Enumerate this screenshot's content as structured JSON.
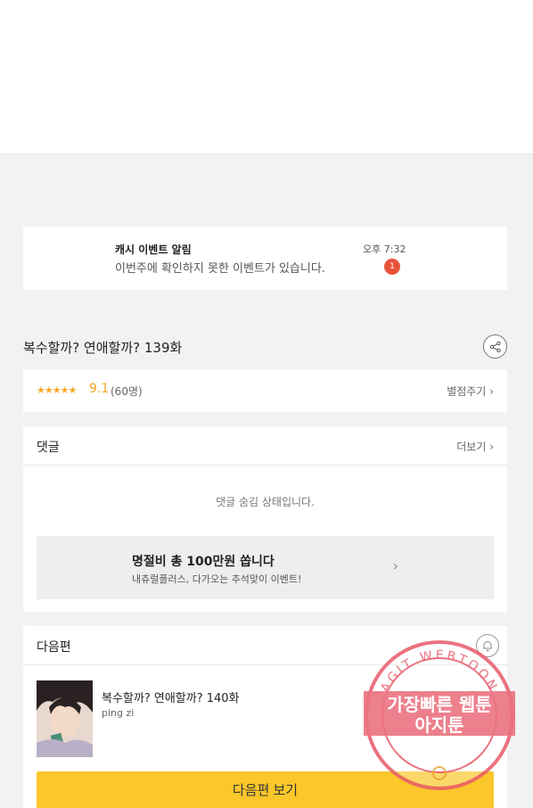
{
  "notice": {
    "title": "캐시 이벤트 알림",
    "body": "이번주에 확인하지 못한 이벤트가 있습니다.",
    "time": "오후 7:32",
    "badge": "1"
  },
  "episode": {
    "title": "복수할까? 연애할까? 139화"
  },
  "rating": {
    "stars": "★★★★★",
    "score": "9.1",
    "count": "(60명)",
    "rate_link": "별점주기"
  },
  "comments": {
    "title": "댓글",
    "more": "더보기",
    "hidden_msg": "댓글 숨김 상태입니다.",
    "banner_title": "명절비 총 100만원 쏩니다",
    "banner_sub": "내츄럴플러스, 다가오는 추석맞이 이벤트!"
  },
  "next": {
    "section_title": "다음편",
    "title": "복수할까? 연애할까? 140화",
    "author": "ping zi",
    "button": "다음편 보기"
  },
  "watermark": {
    "top_text": "AGIT WEBTOON",
    "line1": "가장빠른 웹툰",
    "line2": "아지툰"
  },
  "colors": {
    "accent_star": "#f5a623",
    "badge": "#e8543b",
    "next_button": "#fbc72b",
    "watermark": "#e85a6a"
  }
}
